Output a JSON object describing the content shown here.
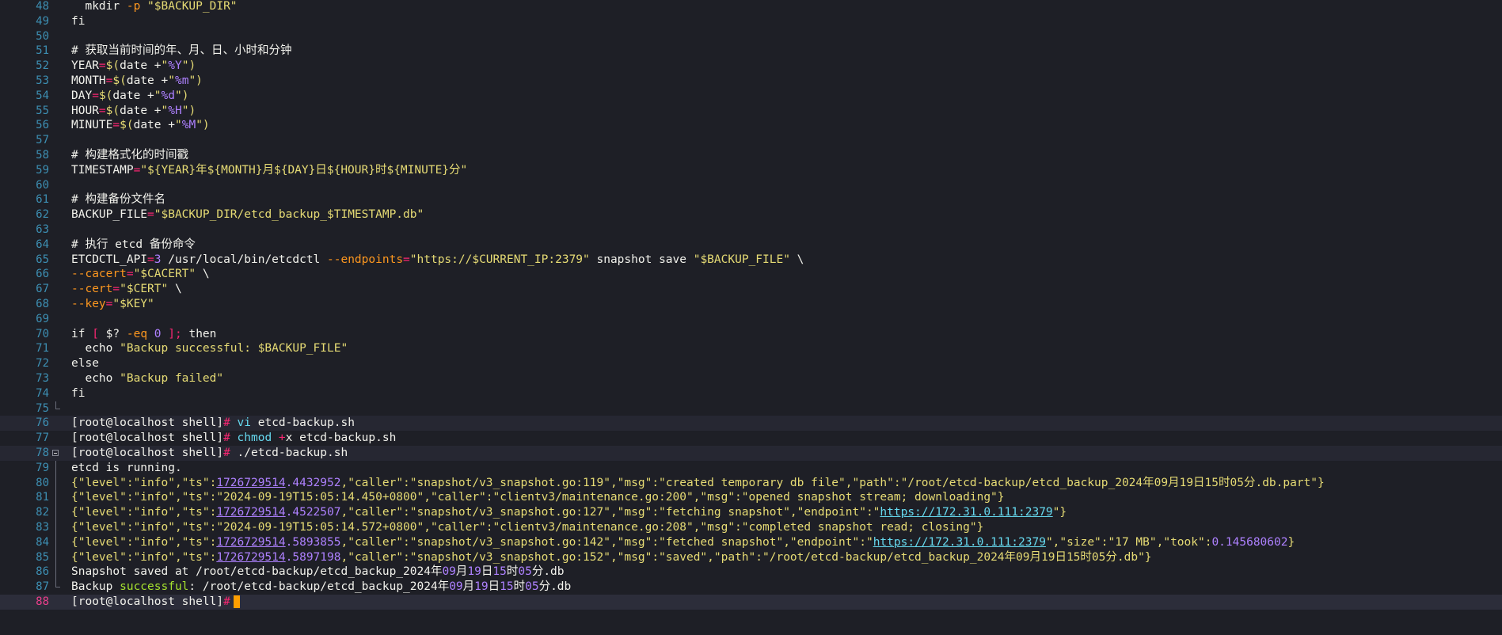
{
  "lines": [
    {
      "n": "48",
      "parts": [
        [
          "plain",
          "  mkdir "
        ],
        [
          "org",
          "-p "
        ],
        [
          "str",
          "\"$BACKUP_DIR\""
        ]
      ]
    },
    {
      "n": "49",
      "parts": [
        [
          "plain",
          "fi"
        ]
      ]
    },
    {
      "n": "50",
      "parts": []
    },
    {
      "n": "51",
      "parts": [
        [
          "plain",
          "# 获取当前时间的年、月、日、小时和分钟"
        ]
      ]
    },
    {
      "n": "52",
      "parts": [
        [
          "plain",
          "YEAR"
        ],
        [
          "op",
          "="
        ],
        [
          "str",
          "$("
        ],
        [
          "plain",
          "date +"
        ],
        [
          "str",
          "\""
        ],
        [
          "num",
          "%Y"
        ],
        [
          "str",
          "\")"
        ]
      ]
    },
    {
      "n": "53",
      "parts": [
        [
          "plain",
          "MONTH"
        ],
        [
          "op",
          "="
        ],
        [
          "str",
          "$("
        ],
        [
          "plain",
          "date +"
        ],
        [
          "str",
          "\""
        ],
        [
          "num",
          "%m"
        ],
        [
          "str",
          "\")"
        ]
      ]
    },
    {
      "n": "54",
      "parts": [
        [
          "plain",
          "DAY"
        ],
        [
          "op",
          "="
        ],
        [
          "str",
          "$("
        ],
        [
          "plain",
          "date +"
        ],
        [
          "str",
          "\""
        ],
        [
          "num",
          "%d"
        ],
        [
          "str",
          "\")"
        ]
      ]
    },
    {
      "n": "55",
      "parts": [
        [
          "plain",
          "HOUR"
        ],
        [
          "op",
          "="
        ],
        [
          "str",
          "$("
        ],
        [
          "plain",
          "date +"
        ],
        [
          "str",
          "\""
        ],
        [
          "num",
          "%H"
        ],
        [
          "str",
          "\")"
        ]
      ]
    },
    {
      "n": "56",
      "parts": [
        [
          "plain",
          "MINUTE"
        ],
        [
          "op",
          "="
        ],
        [
          "str",
          "$("
        ],
        [
          "plain",
          "date +"
        ],
        [
          "str",
          "\""
        ],
        [
          "num",
          "%M"
        ],
        [
          "str",
          "\")"
        ]
      ]
    },
    {
      "n": "57",
      "parts": []
    },
    {
      "n": "58",
      "parts": [
        [
          "plain",
          "# 构建格式化的时间戳"
        ]
      ]
    },
    {
      "n": "59",
      "parts": [
        [
          "plain",
          "TIMESTAMP"
        ],
        [
          "op",
          "="
        ],
        [
          "str",
          "\"${YEAR}年${MONTH}月${DAY}日${HOUR}时${MINUTE}分\""
        ]
      ]
    },
    {
      "n": "60",
      "parts": []
    },
    {
      "n": "61",
      "parts": [
        [
          "plain",
          "# 构建备份文件名"
        ]
      ]
    },
    {
      "n": "62",
      "parts": [
        [
          "plain",
          "BACKUP_FILE"
        ],
        [
          "op",
          "="
        ],
        [
          "str",
          "\"$BACKUP_DIR/etcd_backup_$TIMESTAMP.db\""
        ]
      ]
    },
    {
      "n": "63",
      "parts": []
    },
    {
      "n": "64",
      "parts": [
        [
          "plain",
          "# 执行 etcd 备份命令"
        ]
      ]
    },
    {
      "n": "65",
      "parts": [
        [
          "plain",
          "ETCDCTL_API"
        ],
        [
          "op",
          "="
        ],
        [
          "num",
          "3"
        ],
        [
          "plain",
          " /usr/local/bin/etcdctl "
        ],
        [
          "org",
          "--endpoints"
        ],
        [
          "op",
          "="
        ],
        [
          "str",
          "\"https://$CURRENT_IP:2379\""
        ],
        [
          "plain",
          " snapshot save "
        ],
        [
          "str",
          "\"$BACKUP_FILE\""
        ],
        [
          "plain",
          " \\"
        ]
      ]
    },
    {
      "n": "66",
      "parts": [
        [
          "org",
          "--cacert"
        ],
        [
          "op",
          "="
        ],
        [
          "str",
          "\"$CACERT\""
        ],
        [
          "plain",
          " \\"
        ]
      ]
    },
    {
      "n": "67",
      "parts": [
        [
          "org",
          "--cert"
        ],
        [
          "op",
          "="
        ],
        [
          "str",
          "\"$CERT\""
        ],
        [
          "plain",
          " \\"
        ]
      ]
    },
    {
      "n": "68",
      "parts": [
        [
          "org",
          "--key"
        ],
        [
          "op",
          "="
        ],
        [
          "str",
          "\"$KEY\""
        ]
      ]
    },
    {
      "n": "69",
      "parts": []
    },
    {
      "n": "70",
      "parts": [
        [
          "plain",
          "if "
        ],
        [
          "op",
          "[ "
        ],
        [
          "plain",
          "$? "
        ],
        [
          "org",
          "-eq "
        ],
        [
          "num",
          "0"
        ],
        [
          "op",
          " ];"
        ],
        [
          "plain",
          " then"
        ]
      ]
    },
    {
      "n": "71",
      "parts": [
        [
          "plain",
          "  echo "
        ],
        [
          "str",
          "\"Backup successful: $BACKUP_FILE\""
        ]
      ]
    },
    {
      "n": "72",
      "parts": [
        [
          "plain",
          "else"
        ]
      ]
    },
    {
      "n": "73",
      "parts": [
        [
          "plain",
          "  echo "
        ],
        [
          "str",
          "\"Backup failed\""
        ]
      ]
    },
    {
      "n": "74",
      "parts": [
        [
          "plain",
          "fi"
        ]
      ]
    },
    {
      "n": "75",
      "parts": [],
      "fold": "end"
    },
    {
      "n": "76",
      "hl": true,
      "parts": [
        [
          "plain",
          "[root@localhost shell]"
        ],
        [
          "op",
          "# "
        ],
        [
          "cyan",
          "vi"
        ],
        [
          "plain",
          " etcd-backup.sh"
        ]
      ]
    },
    {
      "n": "77",
      "parts": [
        [
          "plain",
          "[root@localhost shell]"
        ],
        [
          "op",
          "# "
        ],
        [
          "cyan",
          "chmod"
        ],
        [
          "plain",
          " "
        ],
        [
          "op",
          "+"
        ],
        [
          "plain",
          "x etcd-backup.sh"
        ]
      ]
    },
    {
      "n": "78",
      "hl": true,
      "fold": "box",
      "parts": [
        [
          "plain",
          "[root@localhost shell]"
        ],
        [
          "op",
          "# "
        ],
        [
          "plain",
          "./etcd-backup.sh"
        ]
      ]
    },
    {
      "n": "79",
      "fold": "bar",
      "parts": [
        [
          "plain",
          "etcd is running."
        ]
      ]
    },
    {
      "n": "80",
      "fold": "bar",
      "parts": [
        [
          "str",
          "{\"level\":\"info\",\"ts\":"
        ],
        [
          "nu",
          "1726729514"
        ],
        [
          "num",
          ".4432952"
        ],
        [
          "str",
          ",\"caller\":\"snapshot/v3_snapshot.go:119\",\"msg\":\"created temporary db file\",\"path\":\"/root/etcd-backup/etcd_backup_2024年09月19日15时05分.db.part\"}"
        ]
      ]
    },
    {
      "n": "81",
      "fold": "bar",
      "parts": [
        [
          "str",
          "{\"level\":\"info\",\"ts\":\"2024-09-19T15:05:14.450+0800\",\"caller\":\"clientv3/maintenance.go:200\",\"msg\":\"opened snapshot stream; downloading\"}"
        ]
      ]
    },
    {
      "n": "82",
      "fold": "bar",
      "parts": [
        [
          "str",
          "{\"level\":\"info\",\"ts\":"
        ],
        [
          "nu",
          "1726729514"
        ],
        [
          "num",
          ".4522507"
        ],
        [
          "str",
          ",\"caller\":\"snapshot/v3_snapshot.go:127\",\"msg\":\"fetching snapshot\",\"endpoint\":\""
        ],
        [
          "url",
          "https://172.31.0.111:2379"
        ],
        [
          "str",
          "\"}"
        ]
      ]
    },
    {
      "n": "83",
      "fold": "bar",
      "parts": [
        [
          "str",
          "{\"level\":\"info\",\"ts\":\"2024-09-19T15:05:14.572+0800\",\"caller\":\"clientv3/maintenance.go:208\",\"msg\":\"completed snapshot read; closing\"}"
        ]
      ]
    },
    {
      "n": "84",
      "fold": "bar",
      "parts": [
        [
          "str",
          "{\"level\":\"info\",\"ts\":"
        ],
        [
          "nu",
          "1726729514"
        ],
        [
          "num",
          ".5893855"
        ],
        [
          "str",
          ",\"caller\":\"snapshot/v3_snapshot.go:142\",\"msg\":\"fetched snapshot\",\"endpoint\":\""
        ],
        [
          "url",
          "https://172.31.0.111:2379"
        ],
        [
          "str",
          "\",\"size\":\"17 MB\",\"took\":"
        ],
        [
          "num",
          "0.145680602"
        ],
        [
          "str",
          "}"
        ]
      ]
    },
    {
      "n": "85",
      "fold": "bar",
      "parts": [
        [
          "str",
          "{\"level\":\"info\",\"ts\":"
        ],
        [
          "nu",
          "1726729514"
        ],
        [
          "num",
          ".5897198"
        ],
        [
          "str",
          ",\"caller\":\"snapshot/v3_snapshot.go:152\",\"msg\":\"saved\",\"path\":\"/root/etcd-backup/etcd_backup_2024年09月19日15时05分.db\"}"
        ]
      ]
    },
    {
      "n": "86",
      "fold": "bar",
      "parts": [
        [
          "plain",
          "Snapshot saved at /root/etcd-backup/etcd_backup_2024年"
        ],
        [
          "num",
          "09"
        ],
        [
          "plain",
          "月"
        ],
        [
          "num",
          "19"
        ],
        [
          "plain",
          "日"
        ],
        [
          "num",
          "15"
        ],
        [
          "plain",
          "时"
        ],
        [
          "num",
          "05"
        ],
        [
          "plain",
          "分.db"
        ]
      ]
    },
    {
      "n": "87",
      "fold": "end",
      "parts": [
        [
          "plain",
          "Backup "
        ],
        [
          "green",
          "successful"
        ],
        [
          "plain",
          ": /root/etcd-backup/etcd_backup_2024年"
        ],
        [
          "num",
          "09"
        ],
        [
          "plain",
          "月"
        ],
        [
          "num",
          "19"
        ],
        [
          "plain",
          "日"
        ],
        [
          "num",
          "15"
        ],
        [
          "plain",
          "时"
        ],
        [
          "num",
          "05"
        ],
        [
          "plain",
          "分.db"
        ]
      ]
    },
    {
      "n": "88",
      "cur": true,
      "parts": [
        [
          "plain",
          "[root@localhost shell]"
        ],
        [
          "op",
          "#"
        ]
      ],
      "cursor": true
    }
  ],
  "colors": {
    "background": "#1e1f26",
    "line_number": "#3d8fb3",
    "current_line_number": "#ec3f8c",
    "string": "#e6db74",
    "operator": "#f92672",
    "flag": "#fd971f",
    "number": "#ae81ff",
    "cursor": "#ff9f00"
  }
}
